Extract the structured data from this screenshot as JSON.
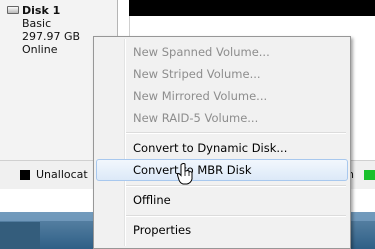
{
  "disk": {
    "name": "Disk 1",
    "type": "Basic",
    "size": "297.97 GB",
    "status": "Online"
  },
  "legend": {
    "unallocated": "Unallocat",
    "partial_right": "n"
  },
  "context_menu": {
    "items": [
      {
        "label": "New Spanned Volume...",
        "enabled": false
      },
      {
        "label": "New Striped Volume...",
        "enabled": false
      },
      {
        "label": "New Mirrored Volume...",
        "enabled": false
      },
      {
        "label": "New RAID-5 Volume...",
        "enabled": false
      },
      {
        "label": "Convert to Dynamic Disk...",
        "enabled": true
      },
      {
        "label": "Convert to MBR Disk",
        "enabled": true,
        "highlighted": true
      },
      {
        "label": "Offline",
        "enabled": true
      },
      {
        "label": "Properties",
        "enabled": true
      }
    ]
  },
  "colors": {
    "unallocated": "#000000",
    "primary_partition": "#19c02c",
    "highlight": "#dce9f8"
  }
}
